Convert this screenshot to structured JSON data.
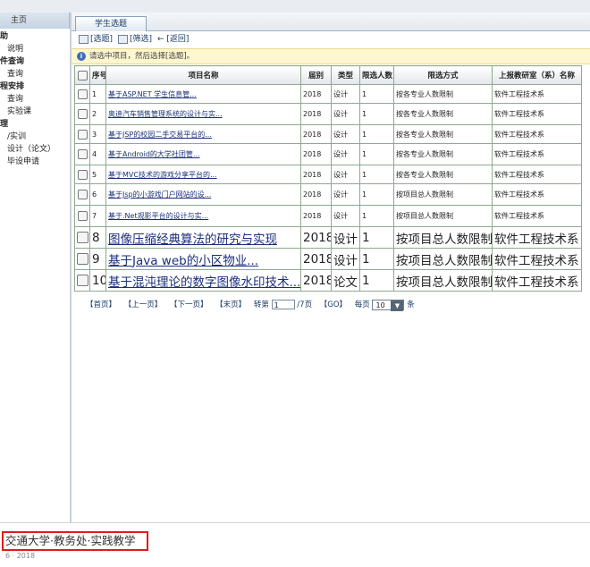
{
  "sidebar": {
    "home_label": "主页",
    "items": [
      {
        "label": "助",
        "group": true
      },
      {
        "label": "说明",
        "group": false
      },
      {
        "label": "件查询",
        "group": true
      },
      {
        "label": "查询",
        "group": false
      },
      {
        "label": "程安排",
        "group": true
      },
      {
        "label": "查询",
        "group": false
      },
      {
        "label": "实验课",
        "group": false
      },
      {
        "label": "理",
        "group": true
      },
      {
        "label": "/实训",
        "group": false
      },
      {
        "label": "设计（论文）",
        "group": false
      },
      {
        "label": "毕设申请",
        "group": false
      }
    ]
  },
  "tab": {
    "label": "学生选题"
  },
  "toolbar": {
    "select": "[选题]",
    "filter": "[筛选]",
    "back_arrow": "←",
    "back": "[返回]"
  },
  "info": {
    "icon": "i",
    "text": "请选中项目，然后选择[选题]。"
  },
  "table": {
    "headers": [
      "序号",
      "项目名称",
      "届别",
      "类型",
      "限选人数",
      "限选方式",
      "上报教研室（系）名称"
    ],
    "rows": [
      {
        "no": "1",
        "name": "基于ASP.NET 学生信息管...",
        "year": "2018",
        "type": "设计",
        "limit": "1",
        "mode": "按各专业人数限制",
        "dept": "软件工程技术系"
      },
      {
        "no": "2",
        "name": "奥迪汽车销售管理系统的设计与实...",
        "year": "2018",
        "type": "设计",
        "limit": "1",
        "mode": "按各专业人数限制",
        "dept": "软件工程技术系"
      },
      {
        "no": "3",
        "name": "基于JSP的校园二手交易平台的...",
        "year": "2018",
        "type": "设计",
        "limit": "1",
        "mode": "按各专业人数限制",
        "dept": "软件工程技术系"
      },
      {
        "no": "4",
        "name": "基于Android的大学社团管...",
        "year": "2018",
        "type": "设计",
        "limit": "1",
        "mode": "按各专业人数限制",
        "dept": "软件工程技术系"
      },
      {
        "no": "5",
        "name": "基于MVC技术的游戏分享平台的...",
        "year": "2018",
        "type": "设计",
        "limit": "1",
        "mode": "按各专业人数限制",
        "dept": "软件工程技术系"
      },
      {
        "no": "6",
        "name": "基于Jsp的小游戏门户网站的设...",
        "year": "2018",
        "type": "设计",
        "limit": "1",
        "mode": "按项目总人数限制",
        "dept": "软件工程技术系"
      },
      {
        "no": "7",
        "name": "基于.Net观影平台的设计与实...",
        "year": "2018",
        "type": "设计",
        "limit": "1",
        "mode": "按项目总人数限制",
        "dept": "软件工程技术系"
      },
      {
        "no": "8",
        "name": "图像压缩经典算法的研究与实现",
        "year": "2018",
        "type": "设计",
        "limit": "1",
        "mode": "按项目总人数限制",
        "dept": "软件工程技术系"
      },
      {
        "no": "9",
        "name": "基于Java web的小区物业...",
        "year": "2018",
        "type": "设计",
        "limit": "1",
        "mode": "按项目总人数限制",
        "dept": "软件工程技术系"
      },
      {
        "no": "10",
        "name": "基于混沌理论的数字图像水印技术...",
        "year": "2018",
        "type": "论文",
        "limit": "1",
        "mode": "按项目总人数限制",
        "dept": "软件工程技术系"
      }
    ]
  },
  "pager": {
    "first": "【首页】",
    "prev": "【上一页】",
    "next": "【下一页】",
    "last": "【末页】",
    "goto_label": "转第",
    "page_value": "1",
    "total": "/7页",
    "go": "【GO】",
    "per_page_label": "每页",
    "per_page_value": "10",
    "per_page_unit": "条"
  },
  "footer": {
    "brand": "交通大学·教务处·实践教学",
    "year": "6 · 2018"
  },
  "colors": {
    "accent": "#1b2f7a",
    "highlight_box": "#e01b1b",
    "grid_border": "#8fa98f",
    "info_bg": "#fdf6cf"
  }
}
